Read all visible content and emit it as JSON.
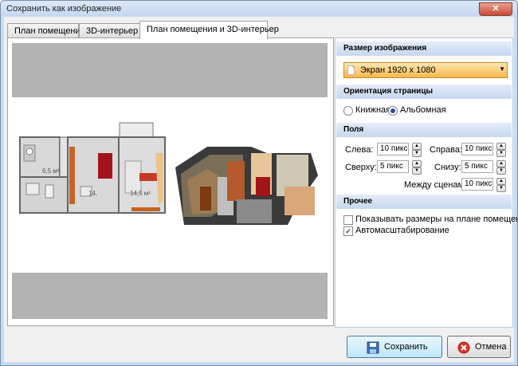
{
  "window": {
    "title": "Сохранить как изображение",
    "close_label": "✕"
  },
  "tabs": [
    {
      "label": "План помещения"
    },
    {
      "label": "3D-интерьер"
    },
    {
      "label": "План помещения и 3D-интерьер"
    }
  ],
  "plan_labels": {
    "room1": "6,5 м²",
    "room2": "14,",
    "room3": "14,5 м²"
  },
  "image_size": {
    "header": "Размер изображения",
    "selected": "Экран 1920 x 1080"
  },
  "orientation": {
    "header": "Ориентация страницы",
    "portrait": "Книжная",
    "landscape": "Альбомная",
    "selected": "landscape"
  },
  "margins": {
    "header": "Поля",
    "left_label": "Слева:",
    "left_value": "10 пикс",
    "right_label": "Справа:",
    "right_value": "10 пикс",
    "top_label": "Сверху:",
    "top_value": "5 пикс",
    "bottom_label": "Снизу:",
    "bottom_value": "5 пикс",
    "between_label": "Между сценами:",
    "between_value": "10 пикс"
  },
  "other": {
    "header": "Прочее",
    "show_sizes_label": "Показывать размеры на плане помещения",
    "show_sizes_checked": false,
    "autoscale_label": "Автомасштабирование",
    "autoscale_checked": true
  },
  "buttons": {
    "save": "Сохранить",
    "cancel": "Отмена"
  },
  "icons": {
    "spin_up": "▲",
    "spin_down": "▼",
    "combo_arrow": "▼",
    "check_mark": "✓"
  }
}
